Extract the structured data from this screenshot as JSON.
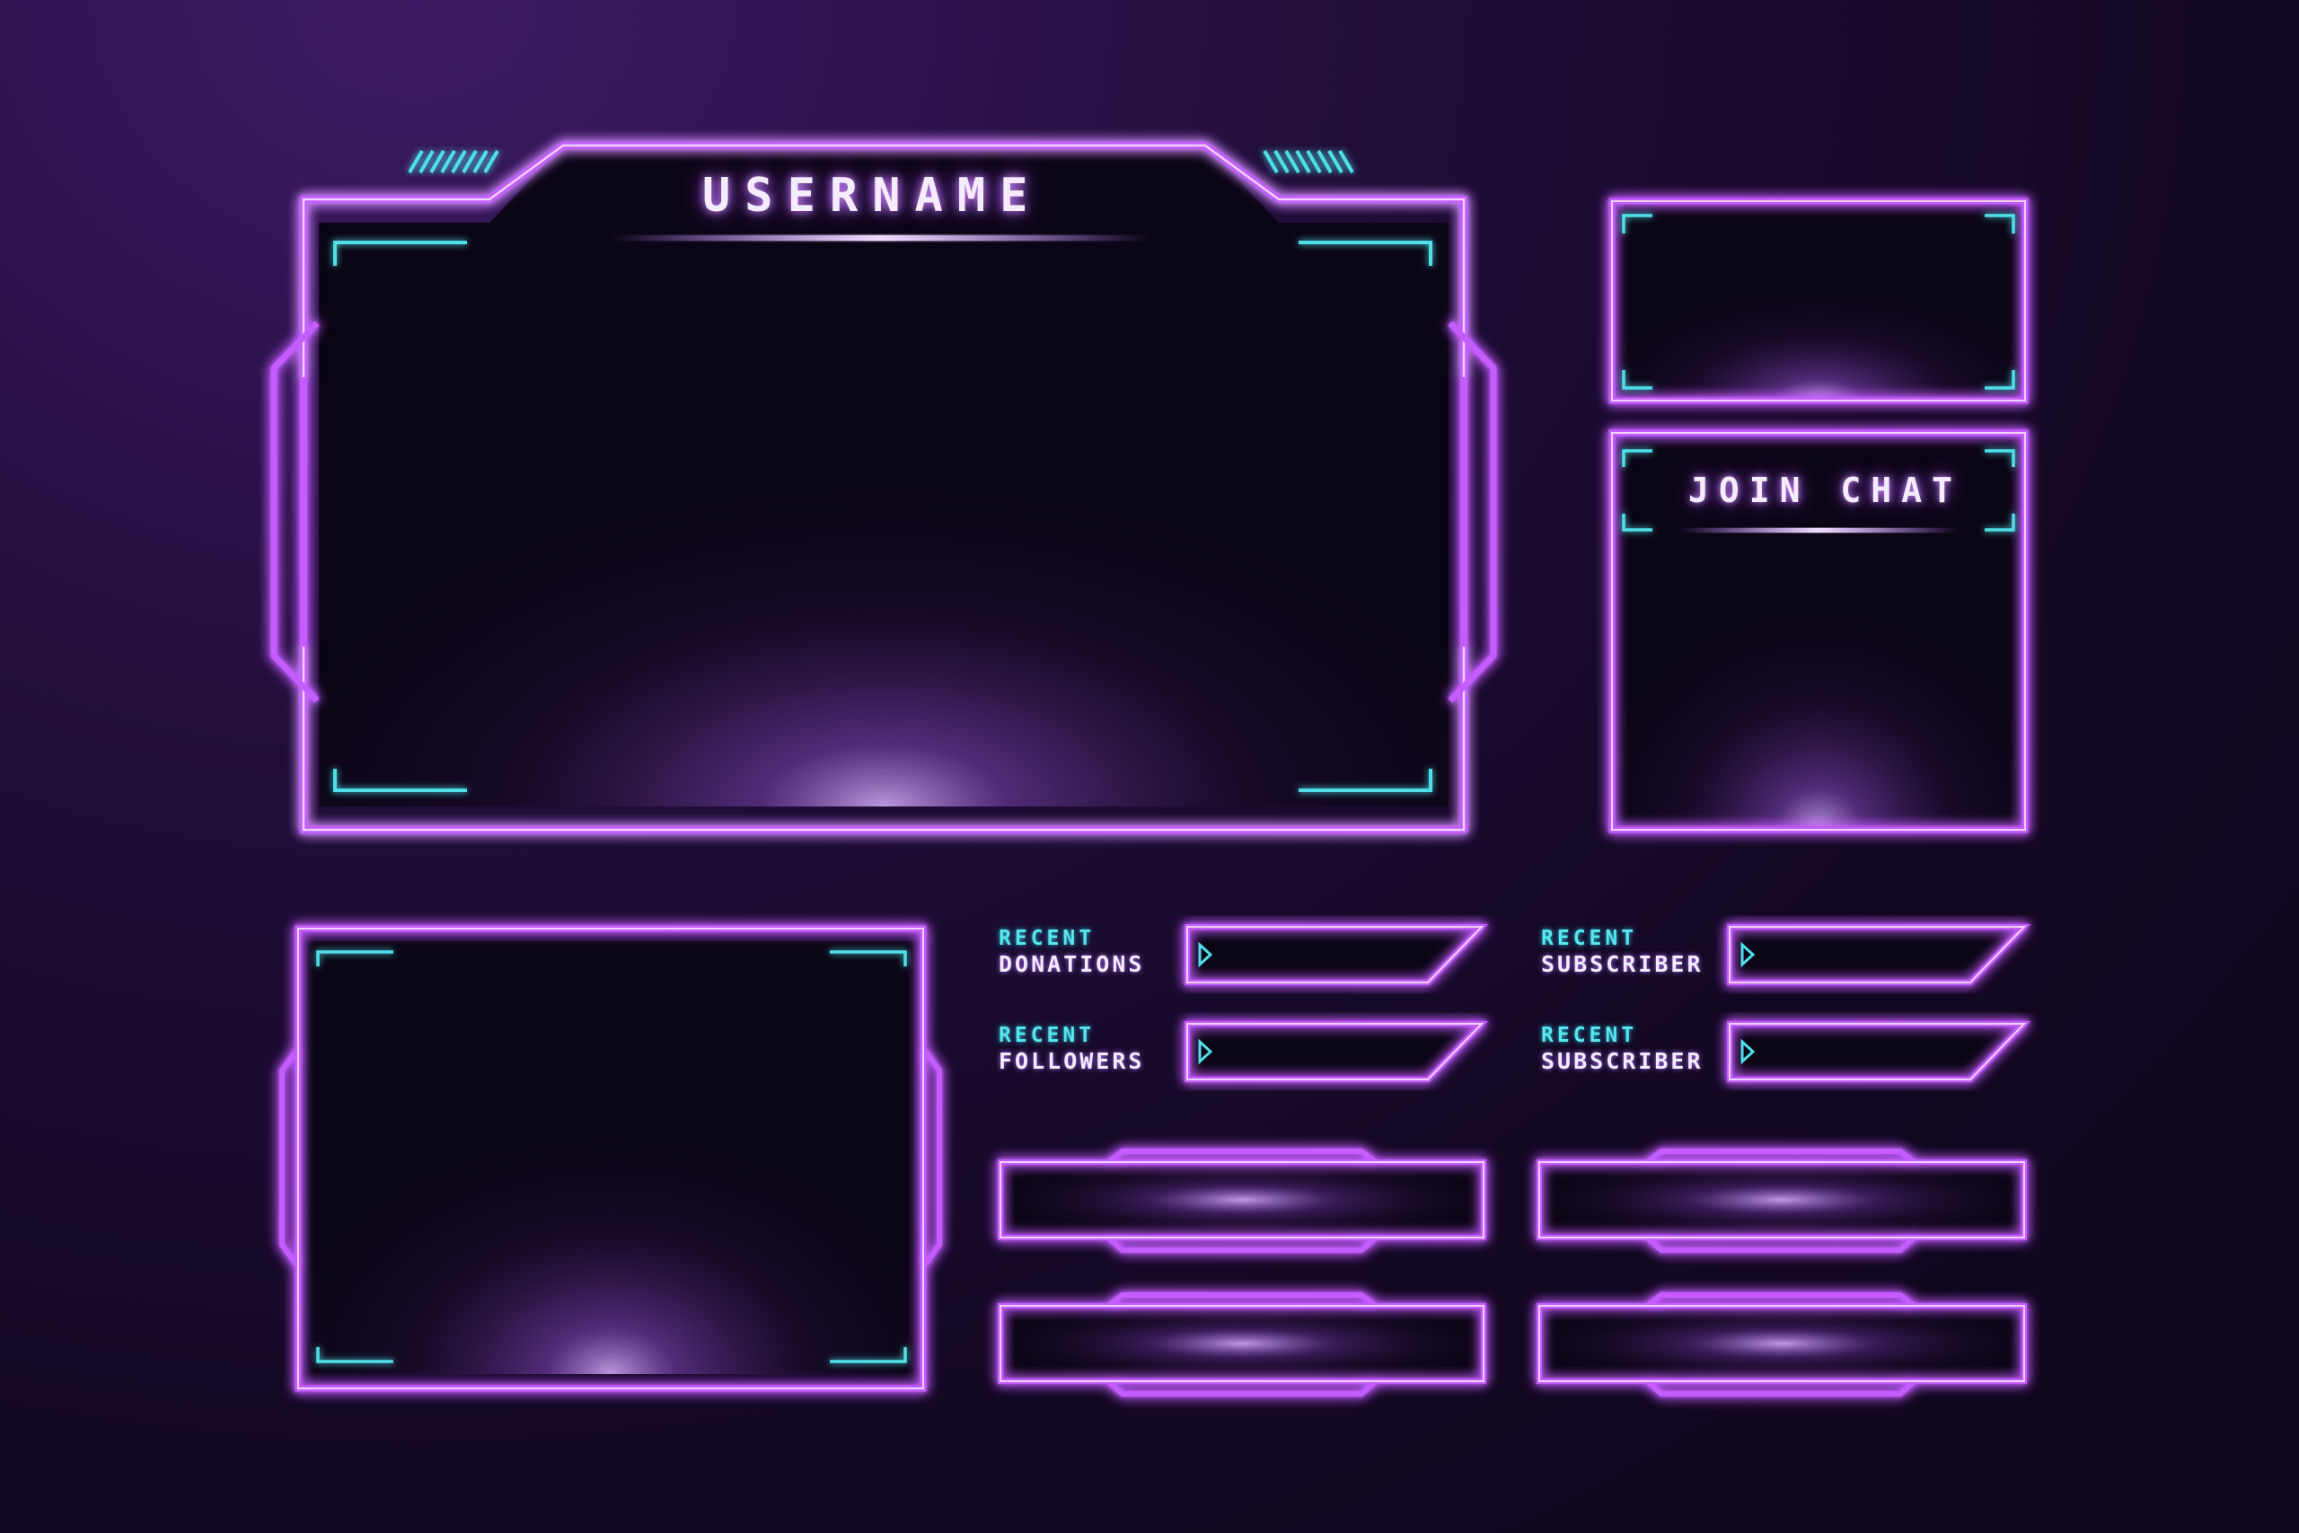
{
  "main_panel": {
    "title": "USERNAME"
  },
  "chat_panel": {
    "title": "JOIN CHAT"
  },
  "recent_labels": [
    {
      "line1": "RECENT",
      "line2": "DONATIONS"
    },
    {
      "line1": "RECENT",
      "line2": "FOLLOWERS"
    },
    {
      "line1": "RECENT",
      "line2": "SUBSCRIBER"
    },
    {
      "line1": "RECENT",
      "line2": "SUBSCRIBER"
    }
  ],
  "colors": {
    "background": "#120822",
    "neon_purple": "#c45cff",
    "neon_purple_core": "#f0d2ff",
    "accent_cyan": "#4fdfe8",
    "panel_fill": "#0a0514"
  },
  "icons": {
    "arrow": "play-triangle-icon"
  }
}
